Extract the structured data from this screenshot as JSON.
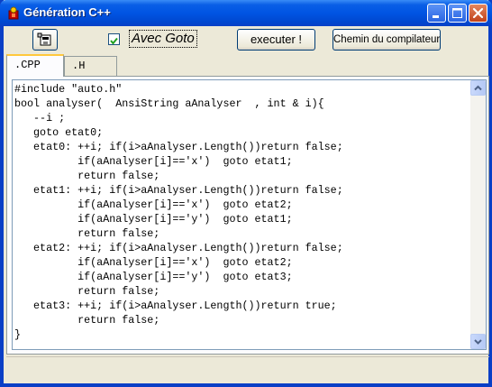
{
  "window": {
    "title": "Génération C++"
  },
  "caption_buttons": {
    "minimize_icon": "minimize-icon",
    "maximize_icon": "maximize-icon",
    "close_icon": "close-icon"
  },
  "toolbar": {
    "save_icon": "save-file-icon",
    "goto_checked": true,
    "goto_label": "Avec Goto",
    "run_label": "executer !",
    "compiler_path_label": "Chemin du compilateur"
  },
  "tabs": [
    {
      "label": ".CPP",
      "active": true
    },
    {
      "label": ".H",
      "active": false
    }
  ],
  "editor": {
    "lines": [
      "#include \"auto.h\"",
      "bool analyser(  AnsiString aAnalyser  , int & i){",
      "   --i ;",
      "   goto etat0;",
      "   etat0: ++i; if(i>aAnalyser.Length())return false;",
      "          if(aAnalyser[i]=='x')  goto etat1;",
      "          return false;",
      "   etat1: ++i; if(i>aAnalyser.Length())return false;",
      "          if(aAnalyser[i]=='x')  goto etat2;",
      "          if(aAnalyser[i]=='y')  goto etat1;",
      "          return false;",
      "   etat2: ++i; if(i>aAnalyser.Length())return false;",
      "          if(aAnalyser[i]=='x')  goto etat2;",
      "          if(aAnalyser[i]=='y')  goto etat3;",
      "          return false;",
      "   etat3: ++i; if(i>aAnalyser.Length())return true;",
      "          return false;",
      "}"
    ]
  },
  "colors": {
    "title_bar": "#0054e3",
    "face": "#ece9d8",
    "close_button": "#c1421a"
  }
}
